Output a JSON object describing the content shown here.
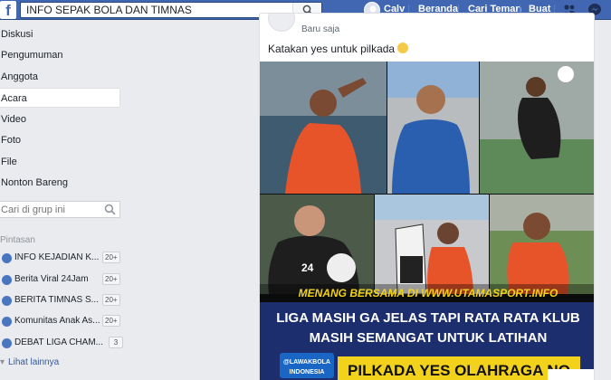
{
  "topbar": {
    "logo": "f",
    "search_value": "INFO SEPAK BOLA DAN TIMNAS",
    "profile_name": "Calv",
    "nav": [
      "Beranda",
      "Cari Teman",
      "Buat"
    ]
  },
  "sidebar": {
    "items": [
      {
        "label": "Diskusi"
      },
      {
        "label": "Pengumuman"
      },
      {
        "label": "Anggota"
      },
      {
        "label": "Acara"
      },
      {
        "label": "Video"
      },
      {
        "label": "Foto"
      },
      {
        "label": "File"
      },
      {
        "label": "Nonton Bareng"
      }
    ],
    "search_placeholder": "Cari di grup ini",
    "shortcuts_title": "Pintasan",
    "shortcuts": [
      {
        "label": "INFO KEJADIAN K...",
        "badge": "20+"
      },
      {
        "label": "Berita Viral 24Jam",
        "badge": "20+"
      },
      {
        "label": "BERITA TIMNAS S...",
        "badge": "20+"
      },
      {
        "label": "Komunitas Anak As...",
        "badge": "20+"
      },
      {
        "label": "DEBAT LIGA CHAM...",
        "badge": "3"
      }
    ],
    "see_more": "Lihat lainnya"
  },
  "post": {
    "time": "Baru saja",
    "text": "Katakan yes untuk pilkada",
    "image": {
      "watermark": "MENANG BERSAMA DI WWW.UTAMASPORT.INFO",
      "headline_line1": "LIGA MASIH GA JELAS TAPI RATA RATA KLUB",
      "headline_line2": "MASIH SEMANGAT UNTUK LATIHAN",
      "badge_line1": "@LAWAKBOLA",
      "badge_line2": "INDONESIA",
      "banner": "PILKADA YES OLAHRAGA NO",
      "jersey_number": "24",
      "panel_colors": {
        "orange_kit": "#e8542a",
        "blue_kit": "#2a5fb0",
        "black_kit": "#1e1e1e",
        "navy_band": "#1c2e6e",
        "yellow_banner": "#f2d21b"
      }
    }
  }
}
